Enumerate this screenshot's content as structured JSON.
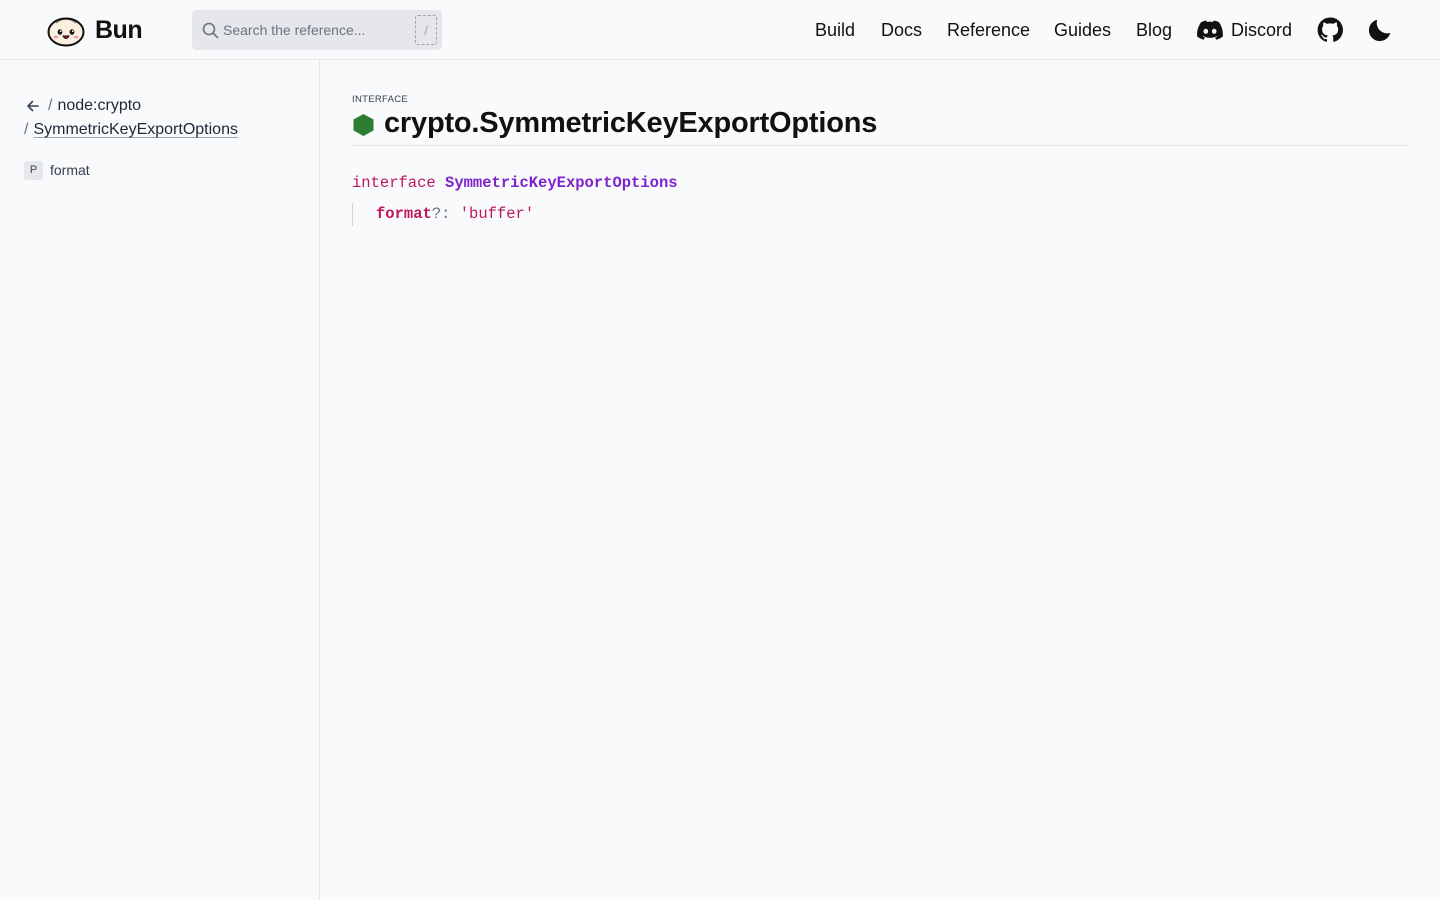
{
  "header": {
    "logo_text": "Bun",
    "search_placeholder": "Search the reference...",
    "search_shortcut": "/",
    "nav": [
      {
        "label": "Build"
      },
      {
        "label": "Docs"
      },
      {
        "label": "Reference"
      },
      {
        "label": "Guides"
      },
      {
        "label": "Blog"
      },
      {
        "label": "Discord"
      }
    ],
    "icons": {
      "discord": "discord-icon",
      "github": "github-icon",
      "theme": "moon-icon"
    }
  },
  "sidebar": {
    "breadcrumb": {
      "sep": "/",
      "module": "node:crypto",
      "current": "SymmetricKeyExportOptions"
    },
    "members": [
      {
        "kind": "P",
        "name": "format"
      }
    ]
  },
  "main": {
    "kind_label": "INTERFACE",
    "title": "crypto.SymmetricKeyExportOptions",
    "kind_color": "#2e7d32",
    "code": {
      "keyword": "interface",
      "type_name": "SymmetricKeyExportOptions",
      "member_name": "format",
      "member_punct": "?: ",
      "member_type": "'buffer'"
    }
  }
}
